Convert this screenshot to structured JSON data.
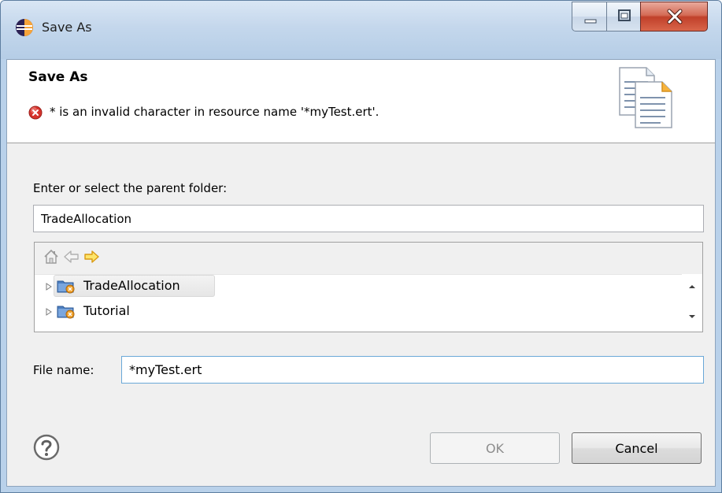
{
  "window": {
    "title": "Save As",
    "controls": {
      "minimize_icon": "minimize-icon",
      "maximize_icon": "maximize-icon",
      "close_icon": "close-icon"
    }
  },
  "banner": {
    "title": "Save As",
    "error_message": "* is an invalid character in resource name '*myTest.ert'.",
    "error_icon": "error-icon",
    "image_icon": "documents-icon"
  },
  "parent_folder": {
    "label": "Enter or select the parent folder:",
    "value": "TradeAllocation"
  },
  "tree": {
    "toolbar": {
      "home_icon": "home-icon",
      "back_icon": "back-arrow-icon",
      "forward_icon": "forward-arrow-icon"
    },
    "items": [
      {
        "label": "TradeAllocation",
        "selected": true,
        "icon": "project-folder-icon"
      },
      {
        "label": "Tutorial",
        "selected": false,
        "icon": "project-folder-icon"
      }
    ]
  },
  "file_name": {
    "label": "File name:",
    "value": "*myTest.ert"
  },
  "buttons": {
    "help_icon": "help-icon",
    "ok": "OK",
    "cancel": "Cancel"
  },
  "colors": {
    "titlebar": "#c4d7ec",
    "close_button": "#c0402a",
    "error_red": "#d7342d",
    "disabled_text": "#8d8d8d"
  }
}
